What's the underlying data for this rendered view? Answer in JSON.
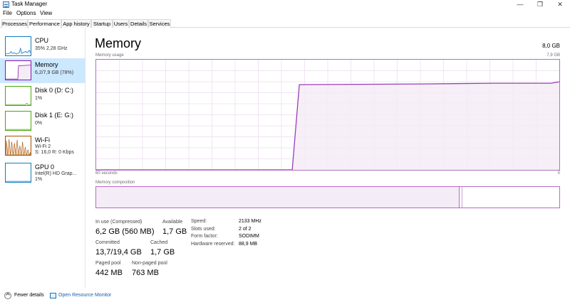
{
  "window": {
    "title": "Task Manager",
    "controls": [
      "—",
      "❐",
      "✕"
    ]
  },
  "menu": [
    "File",
    "Options",
    "View"
  ],
  "tabs": [
    "Processes",
    "Performance",
    "App history",
    "Startup",
    "Users",
    "Details",
    "Services"
  ],
  "active_tab": "Performance",
  "sidebar": [
    {
      "name": "CPU",
      "sub1": "35% 2,28 GHz",
      "color": "#117dbb"
    },
    {
      "name": "Memory",
      "sub1": "6,2/7,9 GB (78%)",
      "color": "#8b12ae",
      "selected": true
    },
    {
      "name": "Disk 0 (D: C:)",
      "sub1": "1%",
      "color": "#4da60c"
    },
    {
      "name": "Disk 1 (E: G:)",
      "sub1": "0%",
      "color": "#4da60c"
    },
    {
      "name": "Wi-Fi",
      "sub1": "Wi-Fi 2",
      "sub2": "S: 16,0 R: 0 Kbps",
      "color": "#a74f01"
    },
    {
      "name": "GPU 0",
      "sub1": "Intel(R) HD Grap...",
      "sub2": "1%",
      "color": "#117dbb"
    }
  ],
  "main": {
    "title": "Memory",
    "total": "8,0 GB",
    "graph_label": "Memory usage",
    "graph_max": "7,9 GB",
    "graph_time": "60 seconds",
    "graph_min": "0",
    "composition_label": "Memory composition",
    "usage_fraction": 0.78
  },
  "stats": {
    "in_use_label": "In use (Compressed)",
    "in_use": "6,2 GB (560 MB)",
    "available_label": "Available",
    "available": "1,7 GB",
    "committed_label": "Committed",
    "committed": "13,7/19,4 GB",
    "cached_label": "Cached",
    "cached": "1,7 GB",
    "paged_label": "Paged pool",
    "paged": "442 MB",
    "nonpaged_label": "Non-paged pool",
    "nonpaged": "763 MB"
  },
  "details": {
    "speed_label": "Speed:",
    "speed": "2133 MHz",
    "slots_label": "Slots used:",
    "slots": "2 of 2",
    "form_label": "Form factor:",
    "form": "SODIMM",
    "reserved_label": "Hardware reserved:",
    "reserved": "88,9 MB"
  },
  "footer": {
    "fewer_details": "Fewer details",
    "open_monitor": "Open Resource Monitor"
  }
}
